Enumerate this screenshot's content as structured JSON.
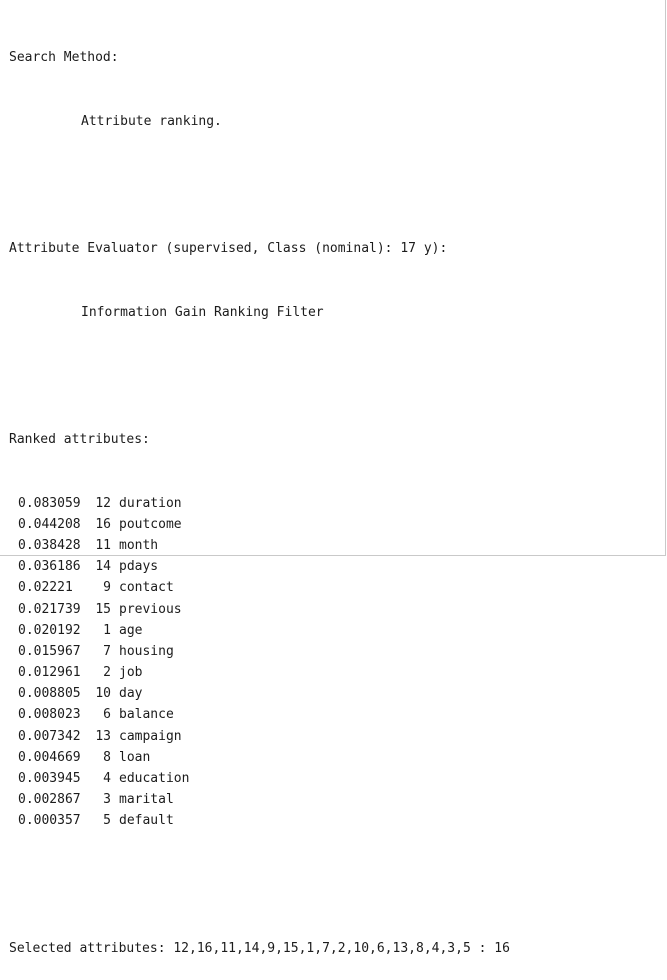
{
  "search_method": {
    "heading": "Search Method:",
    "value": "Attribute ranking."
  },
  "evaluator": {
    "heading": "Attribute Evaluator (supervised, Class (nominal): 17 y):",
    "value": "Information Gain Ranking Filter"
  },
  "ranked": {
    "heading": "Ranked attributes:",
    "rows": [
      {
        "score": "0.083059",
        "index": "12",
        "name": "duration"
      },
      {
        "score": "0.044208",
        "index": "16",
        "name": "poutcome"
      },
      {
        "score": "0.038428",
        "index": "11",
        "name": "month"
      },
      {
        "score": "0.036186",
        "index": "14",
        "name": "pdays"
      },
      {
        "score": "0.02221",
        "index": "9",
        "name": "contact"
      },
      {
        "score": "0.021739",
        "index": "15",
        "name": "previous"
      },
      {
        "score": "0.020192",
        "index": "1",
        "name": "age"
      },
      {
        "score": "0.015967",
        "index": "7",
        "name": "housing"
      },
      {
        "score": "0.012961",
        "index": "2",
        "name": "job"
      },
      {
        "score": "0.008805",
        "index": "10",
        "name": "day"
      },
      {
        "score": "0.008023",
        "index": "6",
        "name": "balance"
      },
      {
        "score": "0.007342",
        "index": "13",
        "name": "campaign"
      },
      {
        "score": "0.004669",
        "index": "8",
        "name": "loan"
      },
      {
        "score": "0.003945",
        "index": "4",
        "name": "education"
      },
      {
        "score": "0.002867",
        "index": "3",
        "name": "marital"
      },
      {
        "score": "0.000357",
        "index": "5",
        "name": "default"
      }
    ]
  },
  "selected": {
    "text": "Selected attributes: 12,16,11,14,9,15,1,7,2,10,6,13,8,4,3,5 : 16"
  }
}
